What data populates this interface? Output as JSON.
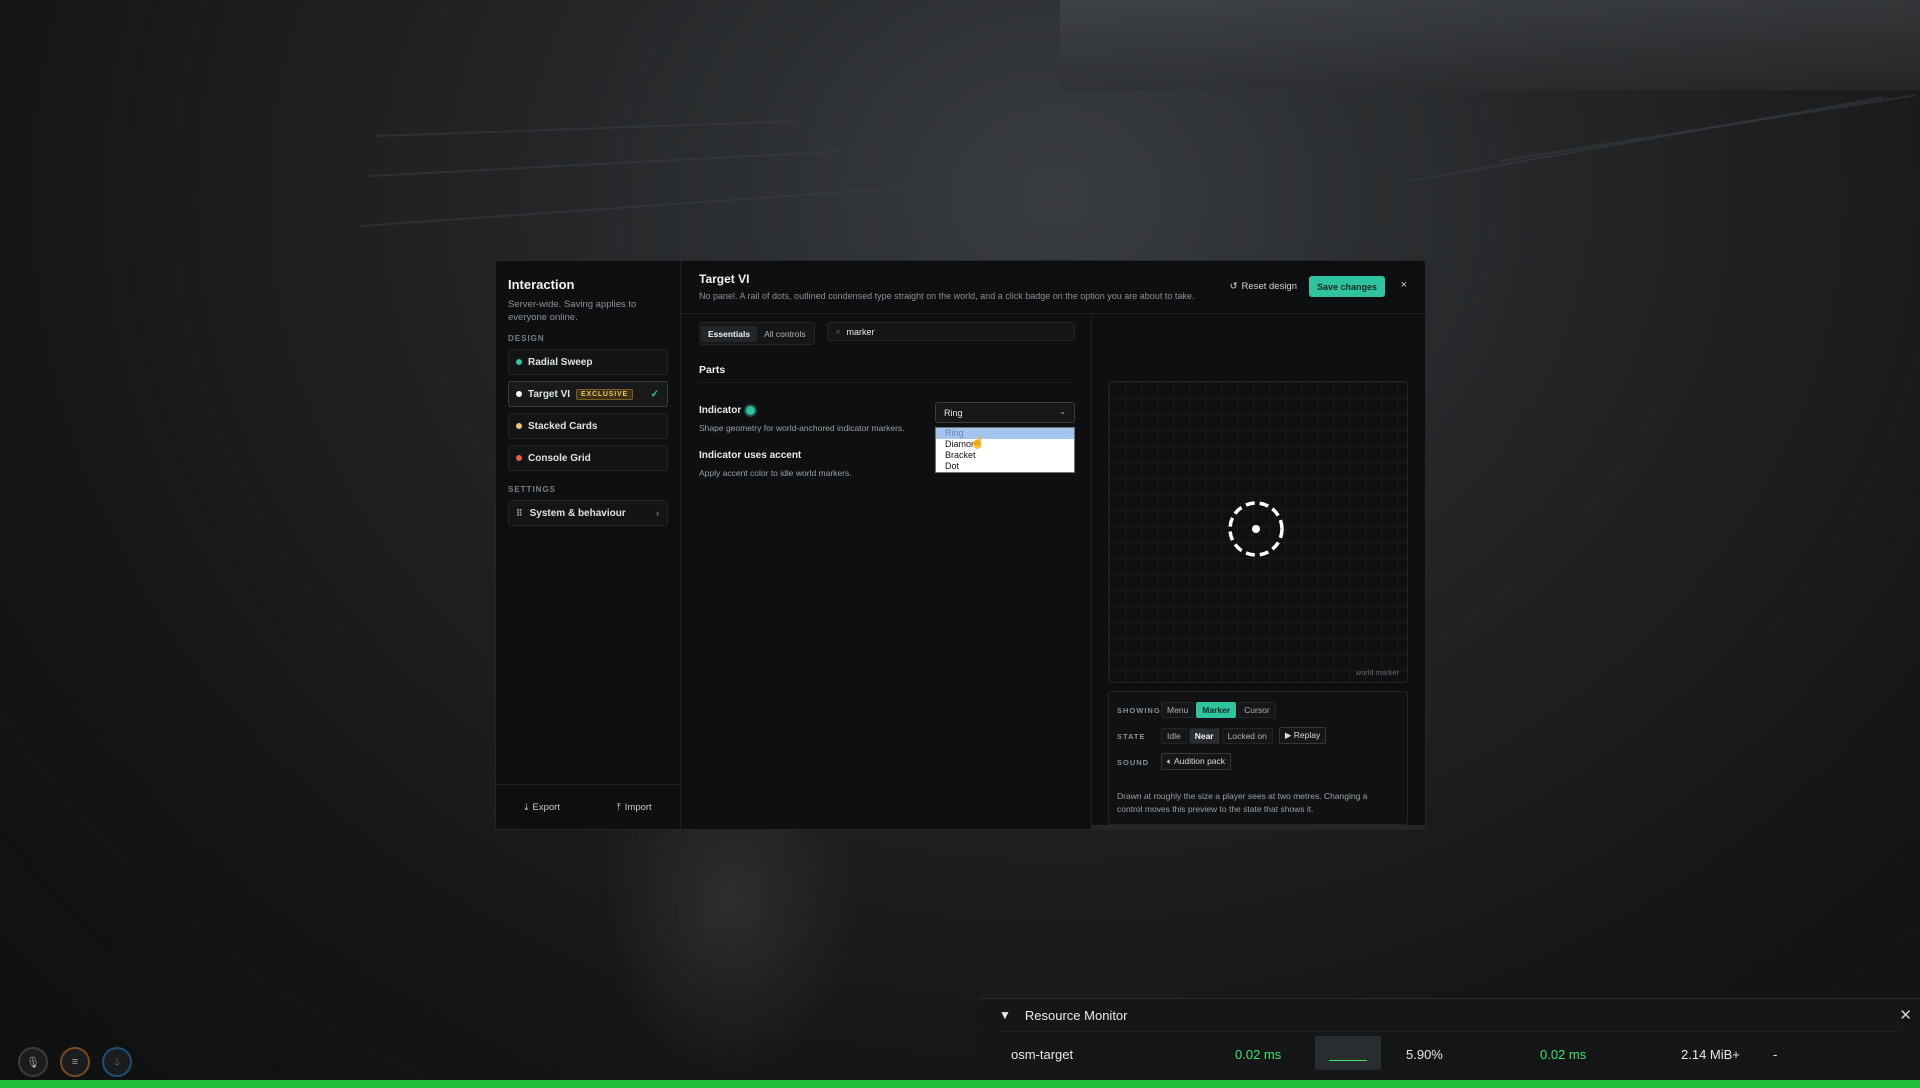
{
  "sidebar": {
    "title": "Interaction",
    "subtitle": "Server-wide. Saving applies to everyone online.",
    "design_label": "DESIGN",
    "items": [
      {
        "label": "Radial Sweep",
        "color": "#2ec4a0"
      },
      {
        "label": "Target VI",
        "badge": "EXCLUSIVE",
        "color": "#ffffff",
        "active": true
      },
      {
        "label": "Stacked Cards",
        "color": "#e9c46a"
      },
      {
        "label": "Console Grid",
        "color": "#e85d4a"
      }
    ],
    "settings_label": "SETTINGS",
    "settings_item": "System & behaviour",
    "export_label": "Export",
    "import_label": "Import"
  },
  "header": {
    "title": "Target VI",
    "subtitle": "No panel. A rail of dots, outlined condensed type straight on the world, and a click badge on the option you are about to take.",
    "reset_label": "Reset design",
    "save_label": "Save changes",
    "close_glyph": "×"
  },
  "editor": {
    "tabs": [
      "Essentials",
      "All controls"
    ],
    "search_value": "marker",
    "section_title": "Parts",
    "indicator_label": "Indicator",
    "indicator_desc": "Shape geometry for world-anchored indicator markers.",
    "indicator_value": "Ring",
    "indicator_options": [
      "Ring",
      "Diamond",
      "Bracket",
      "Dot"
    ],
    "accent_label": "Indicator uses accent",
    "accent_desc": "Apply accent color to idle world markers."
  },
  "preview": {
    "corner_label": "world marker",
    "showing_label": "SHOWING",
    "showing_options": [
      "Menu",
      "Marker",
      "Cursor"
    ],
    "state_label": "STATE",
    "state_options": [
      "Idle",
      "Near",
      "Locked on"
    ],
    "replay_label": "Replay",
    "sound_label": "SOUND",
    "audition_label": "Audition pack",
    "note": "Drawn at roughly the size a player sees at two metres. Changing a control moves this preview to the state that shows it."
  },
  "resource_monitor": {
    "title": "Resource Monitor",
    "resource": "osm-target",
    "cpu_ms": "0.02 ms",
    "percent": "5.90%",
    "avg_ms": "0.02 ms",
    "memory": "2.14 MiB+",
    "extra": "-"
  },
  "colors": {
    "accent": "#2ec4a0",
    "exclusive": "#e9c46a",
    "monitor_green": "#3ee36a"
  }
}
